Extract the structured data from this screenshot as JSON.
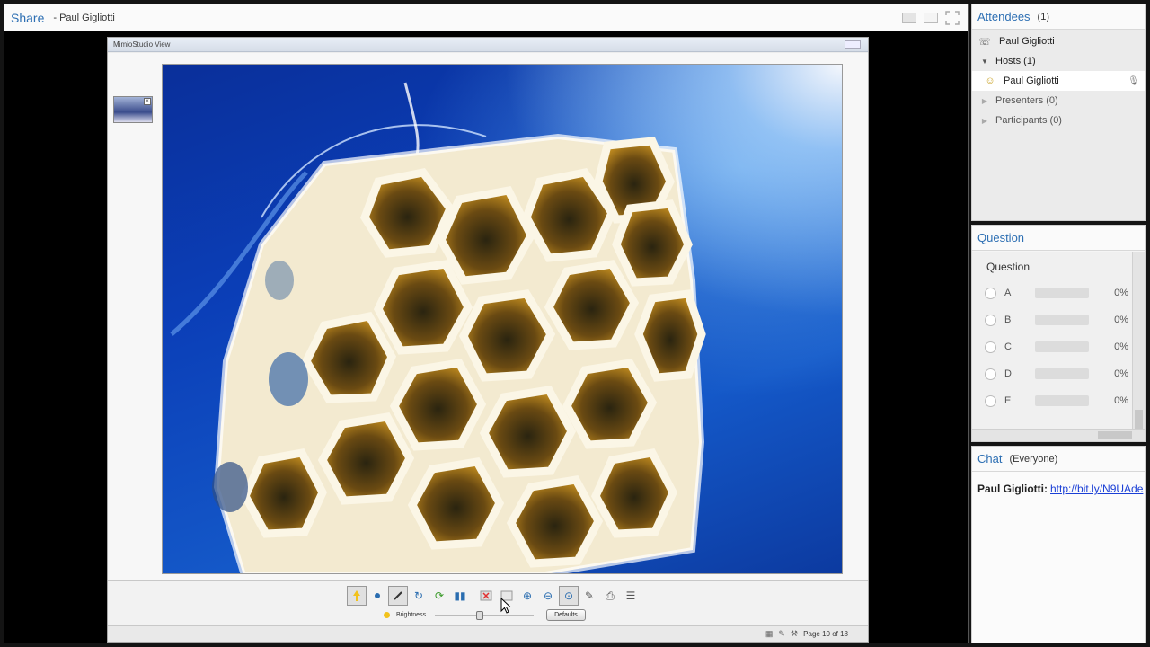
{
  "share": {
    "title": "Share",
    "presenter": "- Paul Gigliotti"
  },
  "mimio": {
    "window_title": "MimioStudio View",
    "brightness_label": "Brightness",
    "brightness_level": 0.45,
    "defaults_label": "Defaults",
    "page_label": "Page 10 of 18"
  },
  "attendees": {
    "title": "Attendees",
    "count": "(1)",
    "me": "Paul Gigliotti",
    "hosts_label": "Hosts (1)",
    "host_name": "Paul Gigliotti",
    "presenters_label": "Presenters (0)",
    "participants_label": "Participants (0)"
  },
  "question": {
    "pod_title": "Question",
    "label": "Question",
    "options": [
      {
        "letter": "A",
        "pct": "0%"
      },
      {
        "letter": "B",
        "pct": "0%"
      },
      {
        "letter": "C",
        "pct": "0%"
      },
      {
        "letter": "D",
        "pct": "0%"
      },
      {
        "letter": "E",
        "pct": "0%"
      }
    ]
  },
  "chat": {
    "title": "Chat",
    "scope": "(Everyone)",
    "sender": "Paul Gigliotti:",
    "message": "http://bit.ly/N9UAde"
  },
  "icons": {
    "toolbar": [
      "pointer-icon",
      "dot-icon",
      "pen-icon",
      "refresh-icon",
      "rotate-icon",
      "pause-icon",
      "stop-icon",
      "window-icon",
      "zoom-in-icon",
      "zoom-out-icon",
      "zoom-fit-icon",
      "draw-icon",
      "print-icon",
      "menu-icon"
    ]
  }
}
